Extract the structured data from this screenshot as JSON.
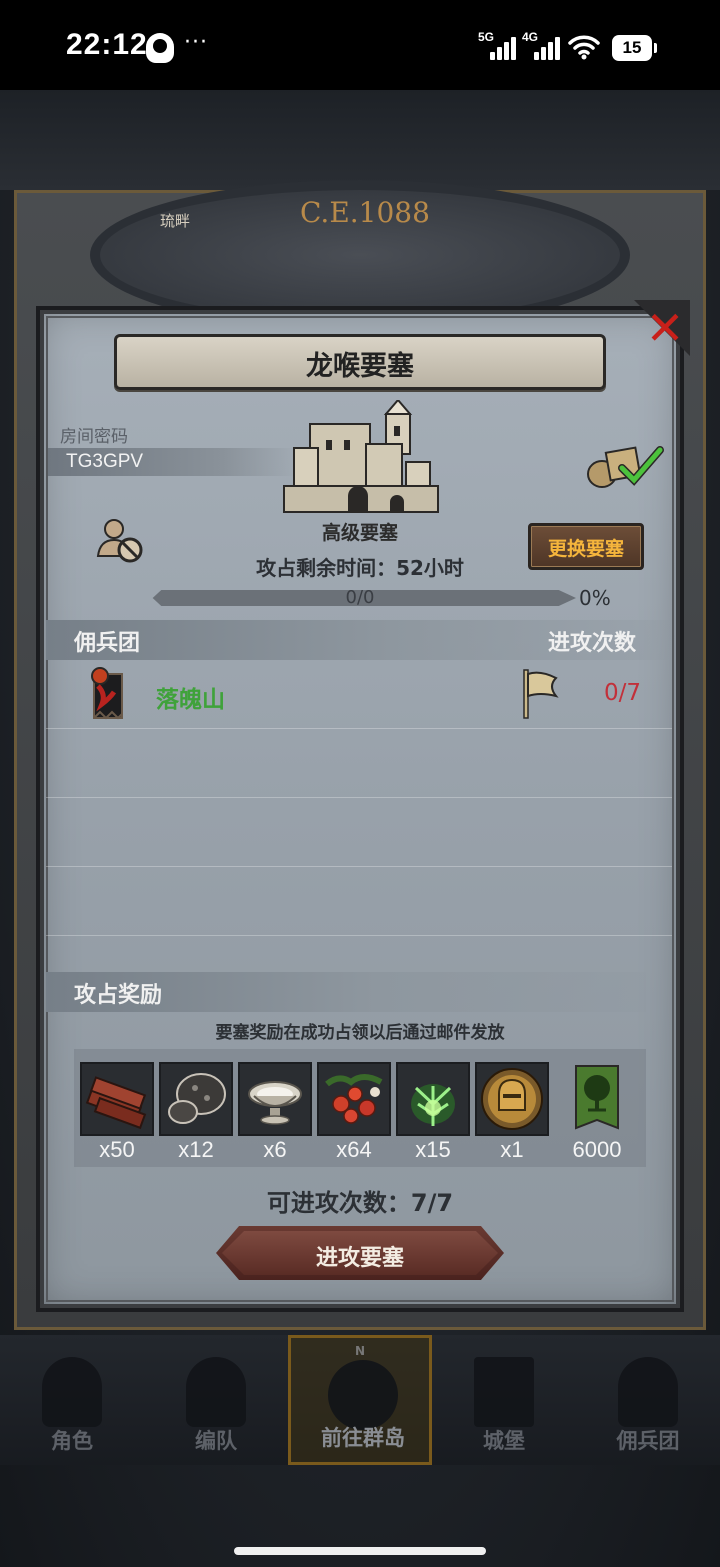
{
  "status_bar": {
    "time": "22:12",
    "dots": "···",
    "network_1": "5G",
    "network_2": "4G",
    "battery": "15"
  },
  "background": {
    "era": "C.E.1088",
    "map_sign": "琉畔"
  },
  "dialog": {
    "title": "龙喉要塞",
    "room_label": "房间密码",
    "room_code": "TG3GPV",
    "fortress_level": "高级要塞",
    "change_fortress_button": "更换要塞",
    "time_left": "攻占剩余时间：52小时",
    "progress_text": "0/0",
    "progress_percent": "0%",
    "progress_fraction": 0,
    "guild_section_title": "佣兵团",
    "attack_count_header": "进攻次数",
    "guild_rows": [
      {
        "name": "落魄山",
        "attacks": "0/7"
      }
    ],
    "reward_section_title": "攻占奖励",
    "reward_note": "要塞奖励在成功占领以后通过邮件发放",
    "rewards": [
      {
        "icon": "wood-planks-icon",
        "qty": "x50"
      },
      {
        "icon": "ore-rock-icon",
        "qty": "x12"
      },
      {
        "icon": "silver-bowl-icon",
        "qty": "x6"
      },
      {
        "icon": "red-berries-icon",
        "qty": "x64"
      },
      {
        "icon": "green-herb-icon",
        "qty": "x15"
      },
      {
        "icon": "knight-helmet-coin-icon",
        "qty": "x1"
      },
      {
        "icon": "guild-tree-banner-icon",
        "qty": "6000"
      }
    ],
    "attempts_left": "可进攻次数：7/7",
    "attack_button": "进攻要塞"
  },
  "bottom_nav": [
    {
      "label": "角色",
      "active": false
    },
    {
      "label": "编队",
      "active": false
    },
    {
      "label": "前往群岛",
      "active": true
    },
    {
      "label": "城堡",
      "active": false
    },
    {
      "label": "佣兵团",
      "active": false
    }
  ],
  "colors": {
    "guild_name": "#3fa23a",
    "attack_count": "#c2303a",
    "change_button_text": "#f5b53c",
    "close_x": "#c8201a"
  }
}
